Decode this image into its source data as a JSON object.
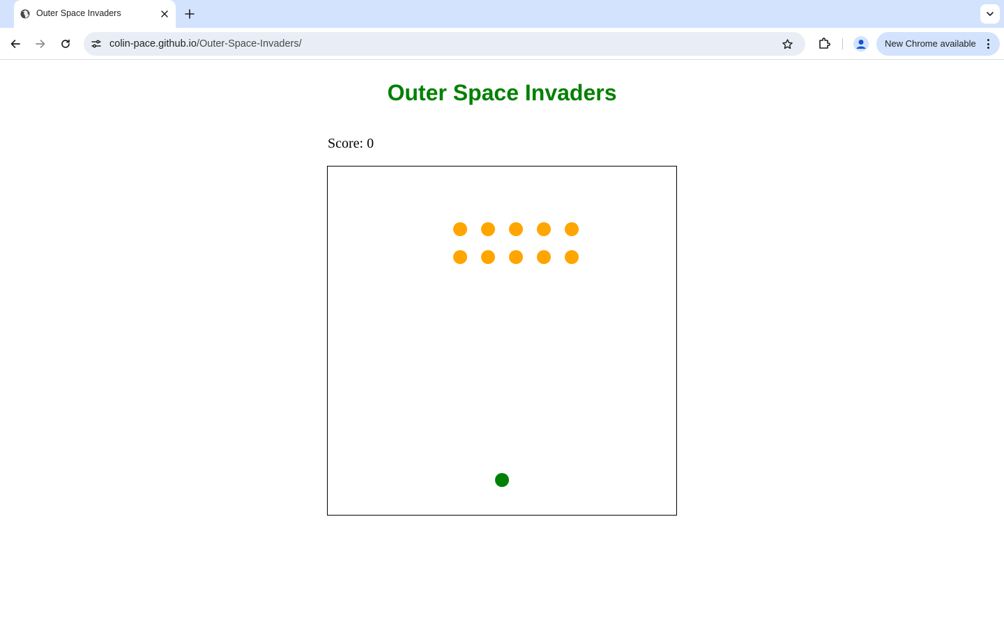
{
  "browser": {
    "tab": {
      "title": "Outer Space Invaders",
      "favicon": "globe-icon"
    },
    "address_bar": {
      "host": "colin-pace.github.io",
      "path": "/Outer-Space-Invaders/"
    },
    "update_chip": {
      "label": "New Chrome available"
    },
    "colors": {
      "tabstrip": "#d3e3fd",
      "omnibox": "#e9eef6"
    }
  },
  "page": {
    "title": "Outer Space Invaders",
    "score_label": "Score: 0",
    "colors": {
      "title": "#008000",
      "invader": "#ffa500",
      "player": "#008000"
    }
  },
  "game": {
    "invader_rows": 2,
    "invaders_per_row": 5,
    "invader_count": 10,
    "player_count": 1
  }
}
